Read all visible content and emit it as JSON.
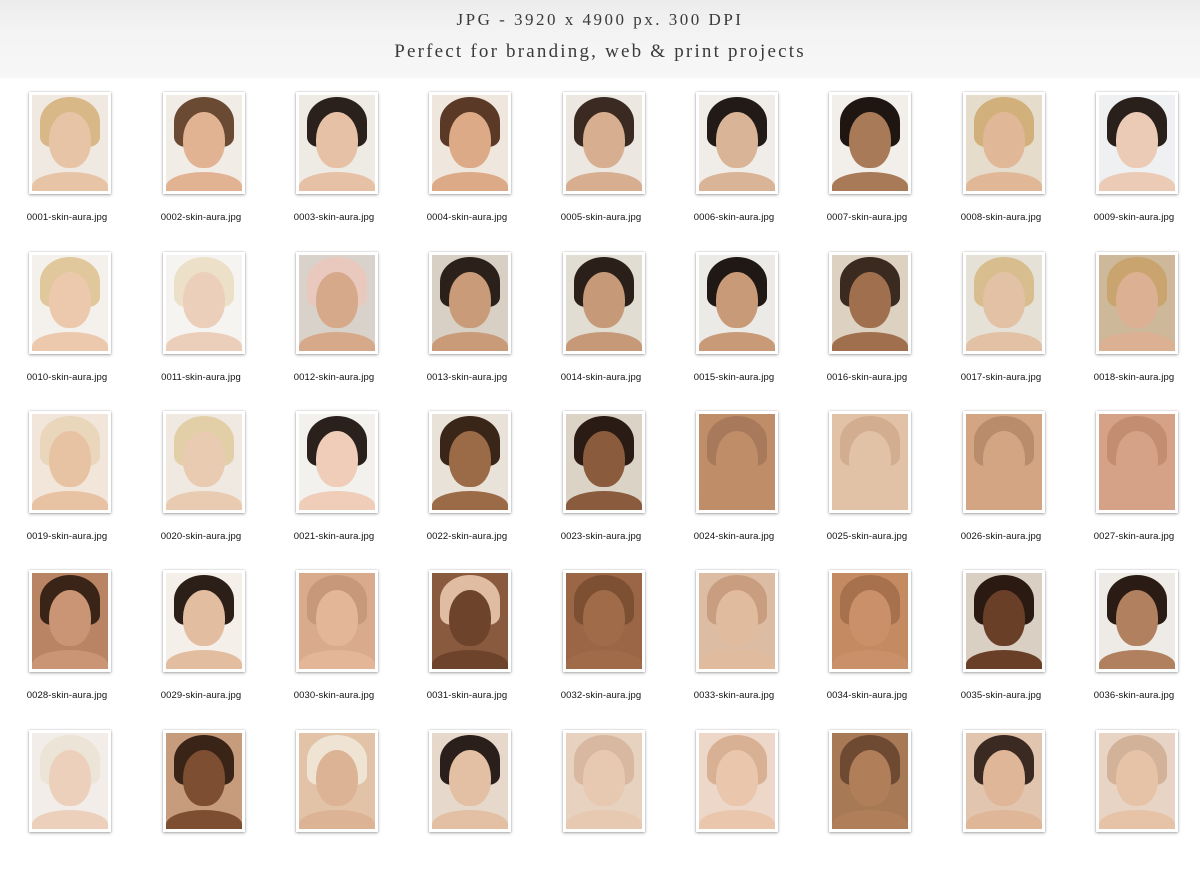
{
  "banner": {
    "line1": "JPG - 3920 x 4900 px. 300 DPI",
    "line2": "Perfect for branding, web & print projects"
  },
  "files": [
    {
      "name": "0001-skin-aura.jpg",
      "bg": "#efe9e2",
      "skin": "#e8c4a6",
      "hair": "#d9b888"
    },
    {
      "name": "0002-skin-aura.jpg",
      "bg": "#f1ece6",
      "skin": "#e2b392",
      "hair": "#6b4a33"
    },
    {
      "name": "0003-skin-aura.jpg",
      "bg": "#eeeae4",
      "skin": "#e6c1a6",
      "hair": "#2b211c"
    },
    {
      "name": "0004-skin-aura.jpg",
      "bg": "#efe6dd",
      "skin": "#dcaa86",
      "hair": "#5a3a27"
    },
    {
      "name": "0005-skin-aura.jpg",
      "bg": "#ece7e1",
      "skin": "#d8ae90",
      "hair": "#3a2a22"
    },
    {
      "name": "0006-skin-aura.jpg",
      "bg": "#f0ede8",
      "skin": "#d9b497",
      "hair": "#221a16"
    },
    {
      "name": "0007-skin-aura.jpg",
      "bg": "#f2efea",
      "skin": "#a97a58",
      "hair": "#1f1612"
    },
    {
      "name": "0008-skin-aura.jpg",
      "bg": "#e6dccb",
      "skin": "#e0b898",
      "hair": "#d1b07c"
    },
    {
      "name": "0009-skin-aura.jpg",
      "bg": "#eef0f2",
      "skin": "#ebcbb5",
      "hair": "#2a201b"
    },
    {
      "name": "0010-skin-aura.jpg",
      "bg": "#f4f1ec",
      "skin": "#ecc9ad",
      "hair": "#e0c79c"
    },
    {
      "name": "0011-skin-aura.jpg",
      "bg": "#f6f4f1",
      "skin": "#eccfba",
      "hair": "#ece0c8"
    },
    {
      "name": "0012-skin-aura.jpg",
      "bg": "#d9d2ca",
      "skin": "#d6a98a",
      "hair": "#e9c8bd"
    },
    {
      "name": "0013-skin-aura.jpg",
      "bg": "#d8d0c4",
      "skin": "#c99b78",
      "hair": "#2b201a"
    },
    {
      "name": "0014-skin-aura.jpg",
      "bg": "#e2ddd2",
      "skin": "#c69a79",
      "hair": "#2a1f19"
    },
    {
      "name": "0015-skin-aura.jpg",
      "bg": "#eceae7",
      "skin": "#c89a78",
      "hair": "#201814"
    },
    {
      "name": "0016-skin-aura.jpg",
      "bg": "#ddd1c2",
      "skin": "#a0704e",
      "hair": "#3a2a20"
    },
    {
      "name": "0017-skin-aura.jpg",
      "bg": "#e6e1d6",
      "skin": "#e3c1a4",
      "hair": "#d8bd8e"
    },
    {
      "name": "0018-skin-aura.jpg",
      "bg": "#cdb89a",
      "skin": "#dcb092",
      "hair": "#c9a46e"
    },
    {
      "name": "0019-skin-aura.jpg",
      "bg": "#f2e6da",
      "skin": "#e8c3a3",
      "hair": "#e9d6bb"
    },
    {
      "name": "0020-skin-aura.jpg",
      "bg": "#efe9e1",
      "skin": "#e9cbb2",
      "hair": "#e2cfa7"
    },
    {
      "name": "0021-skin-aura.jpg",
      "bg": "#f3f1ee",
      "skin": "#efcdb8",
      "hair": "#2b211c"
    },
    {
      "name": "0022-skin-aura.jpg",
      "bg": "#e9e2d8",
      "skin": "#9b6a47",
      "hair": "#3a2618"
    },
    {
      "name": "0023-skin-aura.jpg",
      "bg": "#dcd3c7",
      "skin": "#8a5b3c",
      "hair": "#2a1c14"
    },
    {
      "name": "0024-skin-aura.jpg",
      "bg": "#c08d69",
      "skin": "#c08d69",
      "hair": "#a8795a"
    },
    {
      "name": "0025-skin-aura.jpg",
      "bg": "#e2c2a7",
      "skin": "#e2c2a7",
      "hair": "#d2ad90"
    },
    {
      "name": "0026-skin-aura.jpg",
      "bg": "#d4a583",
      "skin": "#d4a583",
      "hair": "#b98c6c"
    },
    {
      "name": "0027-skin-aura.jpg",
      "bg": "#d5a287",
      "skin": "#d5a287",
      "hair": "#c28d70"
    },
    {
      "name": "0028-skin-aura.jpg",
      "bg": "#b98463",
      "skin": "#c99574",
      "hair": "#3a2418"
    },
    {
      "name": "0029-skin-aura.jpg",
      "bg": "#f4efe9",
      "skin": "#e3bda0",
      "hair": "#2b1f18"
    },
    {
      "name": "0030-skin-aura.jpg",
      "bg": "#d9ab8c",
      "skin": "#e3b698",
      "hair": "#c7987a"
    },
    {
      "name": "0031-skin-aura.jpg",
      "bg": "#8a5a3e",
      "skin": "#6e432b",
      "hair": "#e0bda2"
    },
    {
      "name": "0032-skin-aura.jpg",
      "bg": "#9a6645",
      "skin": "#a06b49",
      "hair": "#7d4f33"
    },
    {
      "name": "0033-skin-aura.jpg",
      "bg": "#dcbda4",
      "skin": "#e1bb9d",
      "hair": "#c99e80"
    },
    {
      "name": "0034-skin-aura.jpg",
      "bg": "#c48a61",
      "skin": "#c99069",
      "hair": "#a8714e"
    },
    {
      "name": "0035-skin-aura.jpg",
      "bg": "#d9d0c3",
      "skin": "#6a3f28",
      "hair": "#2a1a12"
    },
    {
      "name": "0036-skin-aura.jpg",
      "bg": "#eeeae5",
      "skin": "#b0805f",
      "hair": "#2a1c14"
    },
    {
      "name": "",
      "bg": "#f2ede8",
      "skin": "#ecd0bb",
      "hair": "#ece4d6"
    },
    {
      "name": "",
      "bg": "#c79c7c",
      "skin": "#7d4e31",
      "hair": "#3a2418"
    },
    {
      "name": "",
      "bg": "#e2c3a8",
      "skin": "#dcb394",
      "hair": "#efe4d3"
    },
    {
      "name": "",
      "bg": "#e6d9cc",
      "skin": "#e3bfa3",
      "hair": "#2a1f1a"
    },
    {
      "name": "",
      "bg": "#e7d1bf",
      "skin": "#e7c8b0",
      "hair": "#d8b8a0"
    },
    {
      "name": "",
      "bg": "#ecd7c8",
      "skin": "#e9c6ac",
      "hair": "#d8b094"
    },
    {
      "name": "",
      "bg": "#a87955",
      "skin": "#b07e59",
      "hair": "#6f4a33"
    },
    {
      "name": "",
      "bg": "#e2c5ae",
      "skin": "#dfb697",
      "hair": "#3a2a22"
    },
    {
      "name": "",
      "bg": "#e8d4c4",
      "skin": "#e6c3a7",
      "hair": "#d3b29a"
    }
  ]
}
